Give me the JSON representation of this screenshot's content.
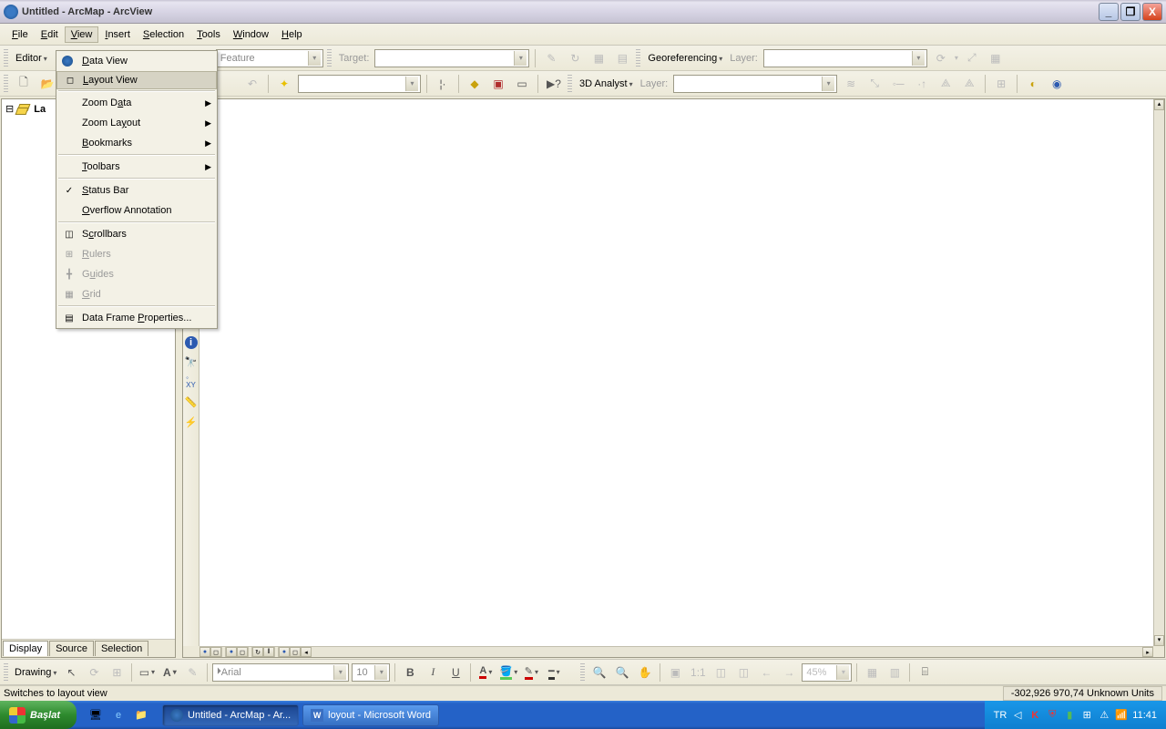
{
  "title": "Untitled - ArcMap - ArcView",
  "menubar": [
    "File",
    "Edit",
    "View",
    "Insert",
    "Selection",
    "Tools",
    "Window",
    "Help"
  ],
  "menubar_underlines": [
    "F",
    "E",
    "V",
    "I",
    "S",
    "T",
    "W",
    "H"
  ],
  "toolbar1": {
    "editor_label": "Editor",
    "feature_combo": "Feature",
    "target_label": "Target:",
    "georef_label": "Georeferencing",
    "layer_label": "Layer:"
  },
  "toolbar2": {
    "analyst_label": "3D Analyst",
    "layer_label": "Layer:"
  },
  "view_menu": {
    "data_view": "Data View",
    "layout_view": "Layout View",
    "zoom_data": "Zoom Data",
    "zoom_layout": "Zoom Layout",
    "bookmarks": "Bookmarks",
    "toolbars": "Toolbars",
    "status_bar": "Status Bar",
    "overflow": "Overflow Annotation",
    "scrollbars": "Scrollbars",
    "rulers": "Rulers",
    "guides": "Guides",
    "grid": "Grid",
    "df_props": "Data Frame Properties..."
  },
  "toc_root": "La",
  "toc_tabs": {
    "display": "Display",
    "source": "Source",
    "selection": "Selection"
  },
  "drawing": {
    "label": "Drawing",
    "font": "Arial",
    "size": "10",
    "percent": "45%"
  },
  "statusbar": {
    "hint": "Switches to layout view",
    "coords": "-302,926 970,74 Unknown Units"
  },
  "taskbar": {
    "start": "Başlat",
    "task1": "Untitled - ArcMap - Ar...",
    "task2": "loyout - Microsoft Word",
    "lang": "TR",
    "clock": "11:41"
  }
}
